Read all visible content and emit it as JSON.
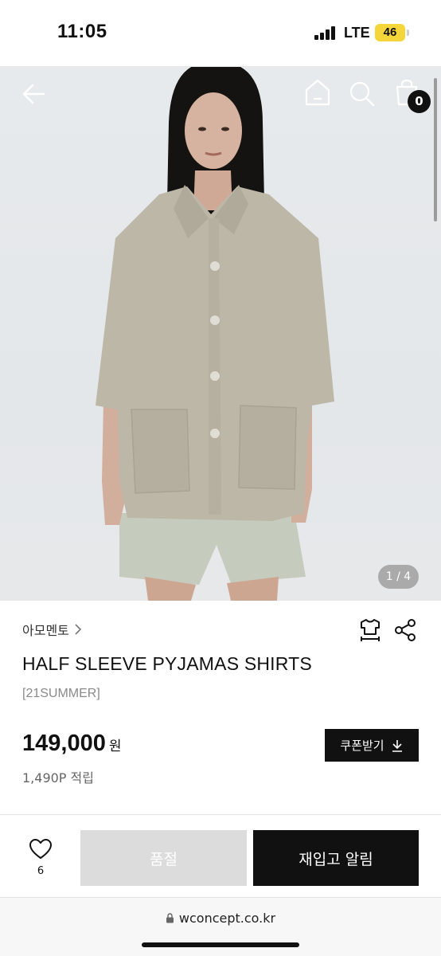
{
  "status_bar": {
    "time": "11:05",
    "network": "LTE",
    "battery": "46"
  },
  "header": {
    "back_icon": "arrow-left-icon",
    "home_icon": "home-icon",
    "search_icon": "search-icon",
    "cart_icon": "shopping-bag-icon",
    "cart_count": "0"
  },
  "gallery": {
    "counter": "1 / 4"
  },
  "product": {
    "brand": "아모멘토",
    "name": "HALF SLEEVE PYJAMAS SHIRTS",
    "season": "[21SUMMER]",
    "price": "149,000",
    "currency": "원",
    "points": "1,490P 적립",
    "coupon_button": "쿠폰받기"
  },
  "actions": {
    "wish_count": "6",
    "soldout_button": "품절",
    "restock_button": "재입고 알림"
  },
  "browser": {
    "url": "wconcept.co.kr"
  },
  "colors": {
    "primary": "#111111",
    "soldout_bg": "#dcdcdc",
    "battery_badge": "#f5d63a"
  }
}
